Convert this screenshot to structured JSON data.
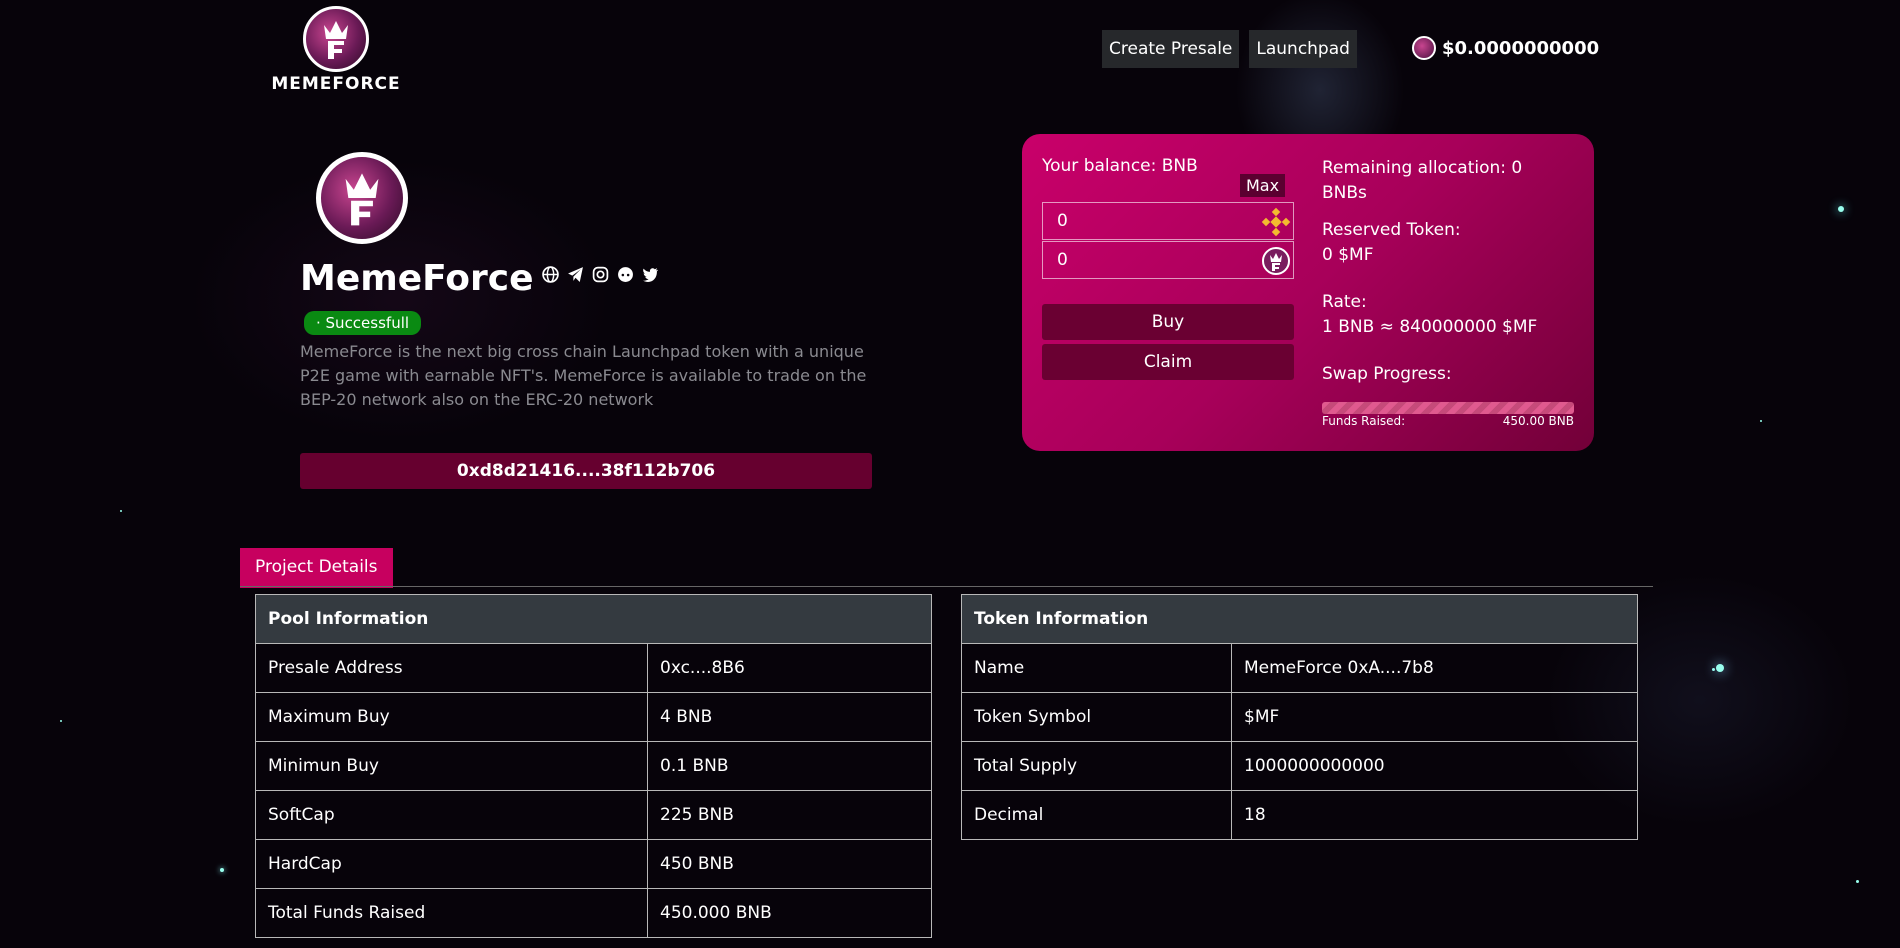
{
  "header": {
    "logo_text": "MEMEFORCE",
    "nav": [
      {
        "label": "Create Presale"
      },
      {
        "label": "Launchpad"
      }
    ],
    "wallet_balance": "$0.0000000000"
  },
  "token": {
    "name": "MemeForce",
    "status": "· Successfull",
    "description": "MemeForce is the next big cross chain Launchpad token with a unique P2E game with earnable NFT's. MemeForce is available to trade on the BEP-20 network also on the ERC-20 network",
    "address": "0xd8d21416....38f112b706",
    "social_icons": [
      "globe-icon",
      "telegram-icon",
      "instagram-icon",
      "reddit-icon",
      "twitter-icon"
    ]
  },
  "swap": {
    "balance_label": "Your balance: BNB",
    "max_label": "Max",
    "bnb_input_value": "0",
    "token_input_value": "0",
    "buy_label": "Buy",
    "claim_label": "Claim",
    "remaining_allocation": "Remaining allocation: 0 BNBs",
    "reserved_label": "Reserved Token:",
    "reserved_value": "0 $MF",
    "rate_label": "Rate:",
    "rate_value": "1 BNB ≈ 840000000 $MF",
    "progress_label": "Swap Progress:",
    "funds_label": "Funds Raised:",
    "funds_value": "450.00 BNB",
    "progress_fraction": 1.0
  },
  "tabs": {
    "project_details": "Project Details"
  },
  "pool_info": {
    "header": "Pool Information",
    "rows": [
      {
        "label": "Presale Address",
        "value": "0xc....8B6"
      },
      {
        "label": "Maximum Buy",
        "value": "4 BNB"
      },
      {
        "label": "Minimun Buy",
        "value": "0.1 BNB"
      },
      {
        "label": "SoftCap",
        "value": "225 BNB"
      },
      {
        "label": "HardCap",
        "value": "450 BNB"
      },
      {
        "label": "Total Funds Raised",
        "value": "450.000 BNB"
      }
    ]
  },
  "token_info": {
    "header": "Token Information",
    "rows": [
      {
        "label": "Name",
        "value": "MemeForce  0xA....7b8"
      },
      {
        "label": "Token Symbol",
        "value": "$MF"
      },
      {
        "label": "Total Supply",
        "value": "1000000000000"
      },
      {
        "label": "Decimal",
        "value": "18"
      }
    ]
  },
  "colors": {
    "accent": "#c7005f",
    "card_gradient_start": "#c9006a",
    "card_gradient_end": "#720038",
    "success": "#0a8a12",
    "background": "#07030a"
  }
}
